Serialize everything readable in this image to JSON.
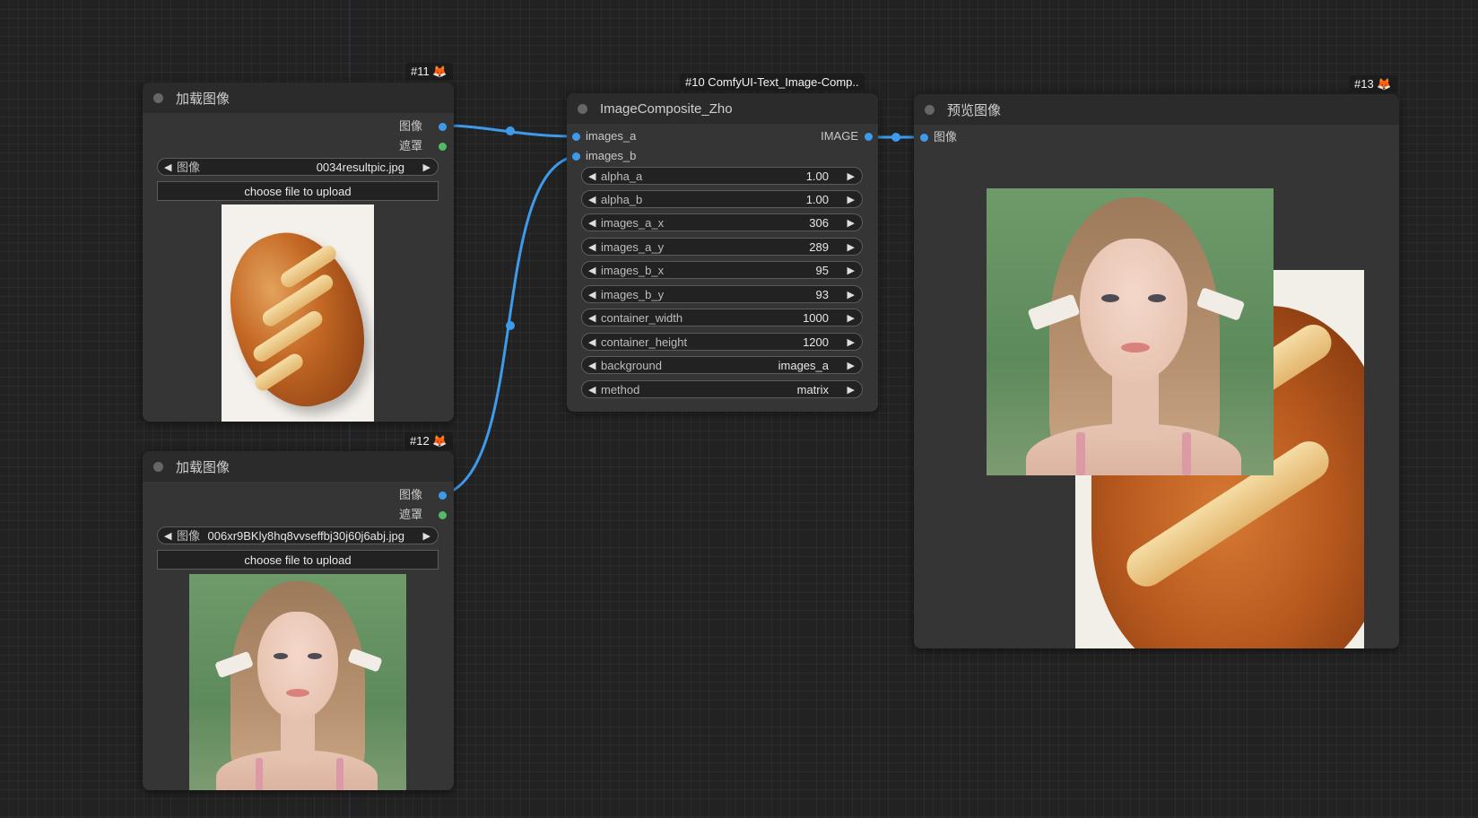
{
  "nodes": {
    "load_image_1": {
      "id_badge": "#11 🦊",
      "title": "加载图像",
      "outputs": [
        "图像",
        "遮罩"
      ],
      "image_widget": {
        "label": "图像",
        "value": "0034resultpic.jpg"
      },
      "upload_label": "choose file to upload"
    },
    "load_image_2": {
      "id_badge": "#12 🦊",
      "title": "加载图像",
      "outputs": [
        "图像",
        "遮罩"
      ],
      "image_widget": {
        "label": "图像",
        "value": "006xr9BKly8hq8vvseffbj30j60j6abj.jpg"
      },
      "upload_label": "choose file to upload"
    },
    "composite": {
      "id_badge": "#10 ComfyUI-Text_Image-Comp..",
      "title": "ImageComposite_Zho",
      "inputs": [
        "images_a",
        "images_b"
      ],
      "output": "IMAGE",
      "widgets": [
        {
          "label": "alpha_a",
          "value": "1.00"
        },
        {
          "label": "alpha_b",
          "value": "1.00"
        },
        {
          "label": "images_a_x",
          "value": "306"
        },
        {
          "label": "images_a_y",
          "value": "289"
        },
        {
          "label": "images_b_x",
          "value": "95"
        },
        {
          "label": "images_b_y",
          "value": "93"
        },
        {
          "label": "container_width",
          "value": "1000"
        },
        {
          "label": "container_height",
          "value": "1200"
        },
        {
          "label": "background",
          "value": "images_a"
        },
        {
          "label": "method",
          "value": "matrix"
        }
      ]
    },
    "preview": {
      "id_badge": "#13 🦊",
      "title": "预览图像",
      "input": "图像"
    }
  },
  "colors": {
    "image_link": "#3e9bec",
    "mask_slot": "#53bb63",
    "node_body": "#353535",
    "node_title": "#2b2b2b"
  }
}
